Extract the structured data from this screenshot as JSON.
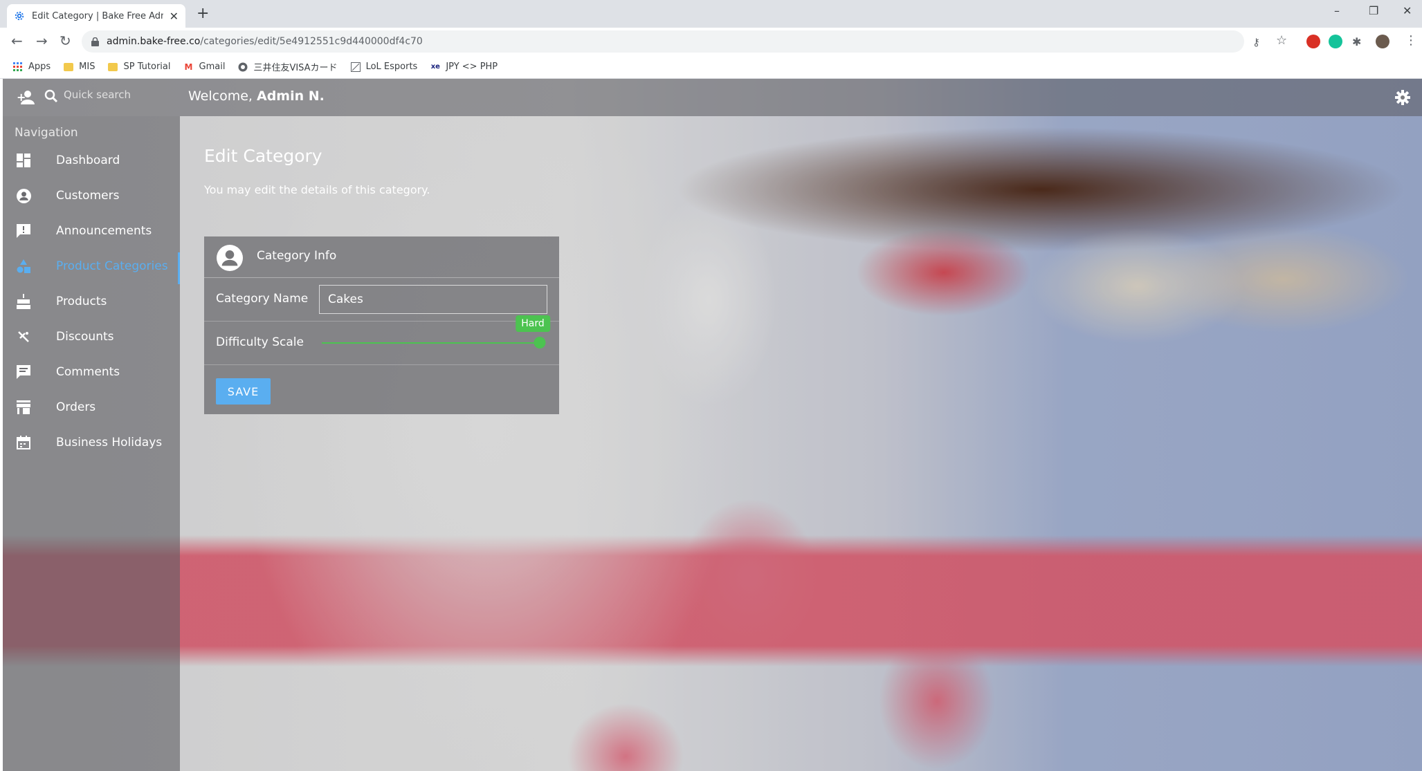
{
  "browser": {
    "tab_title": "Edit Category | Bake Free Admin",
    "url_host": "admin.bake-free.co",
    "url_path": "/categories/edit/5e4912551c9d440000df4c70",
    "bookmarks": [
      {
        "label": "Apps",
        "icon": "apps-grid-icon"
      },
      {
        "label": "MIS",
        "icon": "folder-icon"
      },
      {
        "label": "SP Tutorial",
        "icon": "folder-icon"
      },
      {
        "label": "Gmail",
        "icon": "gmail-icon"
      },
      {
        "label": "三井住友VISAカード",
        "icon": "globe-icon"
      },
      {
        "label": "LoL Esports",
        "icon": "lol-icon"
      },
      {
        "label": "JPY <> PHP",
        "icon": "exchange-icon"
      }
    ]
  },
  "header": {
    "search_placeholder": "Quick search",
    "welcome_prefix": "Welcome,",
    "welcome_name": "Admin N."
  },
  "sidebar": {
    "heading": "Navigation",
    "items": [
      {
        "label": "Dashboard",
        "icon": "dashboard-icon"
      },
      {
        "label": "Customers",
        "icon": "user-circle-icon"
      },
      {
        "label": "Announcements",
        "icon": "announcement-icon"
      },
      {
        "label": "Product Categories",
        "icon": "shapes-icon",
        "active": true
      },
      {
        "label": "Products",
        "icon": "cake-icon"
      },
      {
        "label": "Discounts",
        "icon": "discount-icon"
      },
      {
        "label": "Comments",
        "icon": "comment-icon"
      },
      {
        "label": "Orders",
        "icon": "store-icon"
      },
      {
        "label": "Business Holidays",
        "icon": "calendar-icon"
      }
    ]
  },
  "main": {
    "title": "Edit Category",
    "subtitle": "You may edit the details of this category.",
    "card": {
      "title": "Category Info",
      "name_label": "Category Name",
      "name_value": "Cakes",
      "difficulty_label": "Difficulty Scale",
      "difficulty_value_label": "Hard",
      "difficulty_fraction": 1.0,
      "save_label": "SAVE"
    }
  },
  "colors": {
    "accent": "#5aaef0",
    "slider": "#4cc350"
  }
}
